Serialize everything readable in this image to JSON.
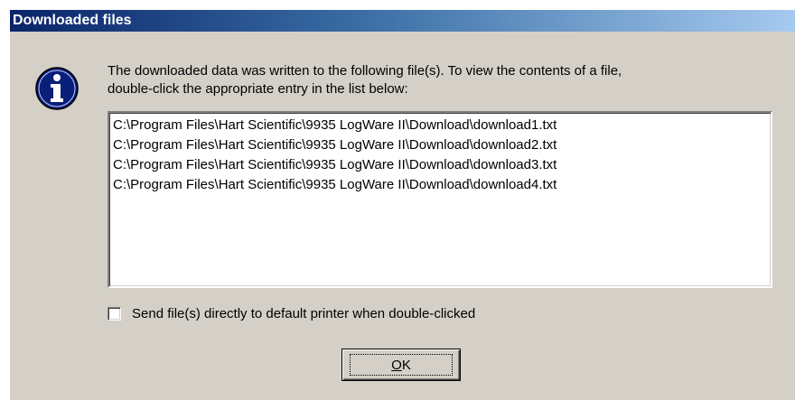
{
  "window": {
    "title": "Downloaded files"
  },
  "icon": {
    "name": "info-icon",
    "color": "#0a1f7a"
  },
  "message": {
    "line1": "The downloaded data was written to the following file(s). To view the contents of a file,",
    "line2": "double-click the appropriate entry in the list below:"
  },
  "files": [
    "C:\\Program Files\\Hart Scientific\\9935 LogWare II\\Download\\download1.txt",
    "C:\\Program Files\\Hart Scientific\\9935 LogWare II\\Download\\download2.txt",
    "C:\\Program Files\\Hart Scientific\\9935 LogWare II\\Download\\download3.txt",
    "C:\\Program Files\\Hart Scientific\\9935 LogWare II\\Download\\download4.txt"
  ],
  "print_option": {
    "label": "Send file(s) directly to default printer when double-clicked",
    "checked": false
  },
  "buttons": {
    "ok_mnemonic": "O",
    "ok_rest": "K"
  },
  "colors": {
    "titlebar_start": "#0a246a",
    "titlebar_end": "#a6caf0",
    "dialog_bg": "#d4d0c8"
  }
}
